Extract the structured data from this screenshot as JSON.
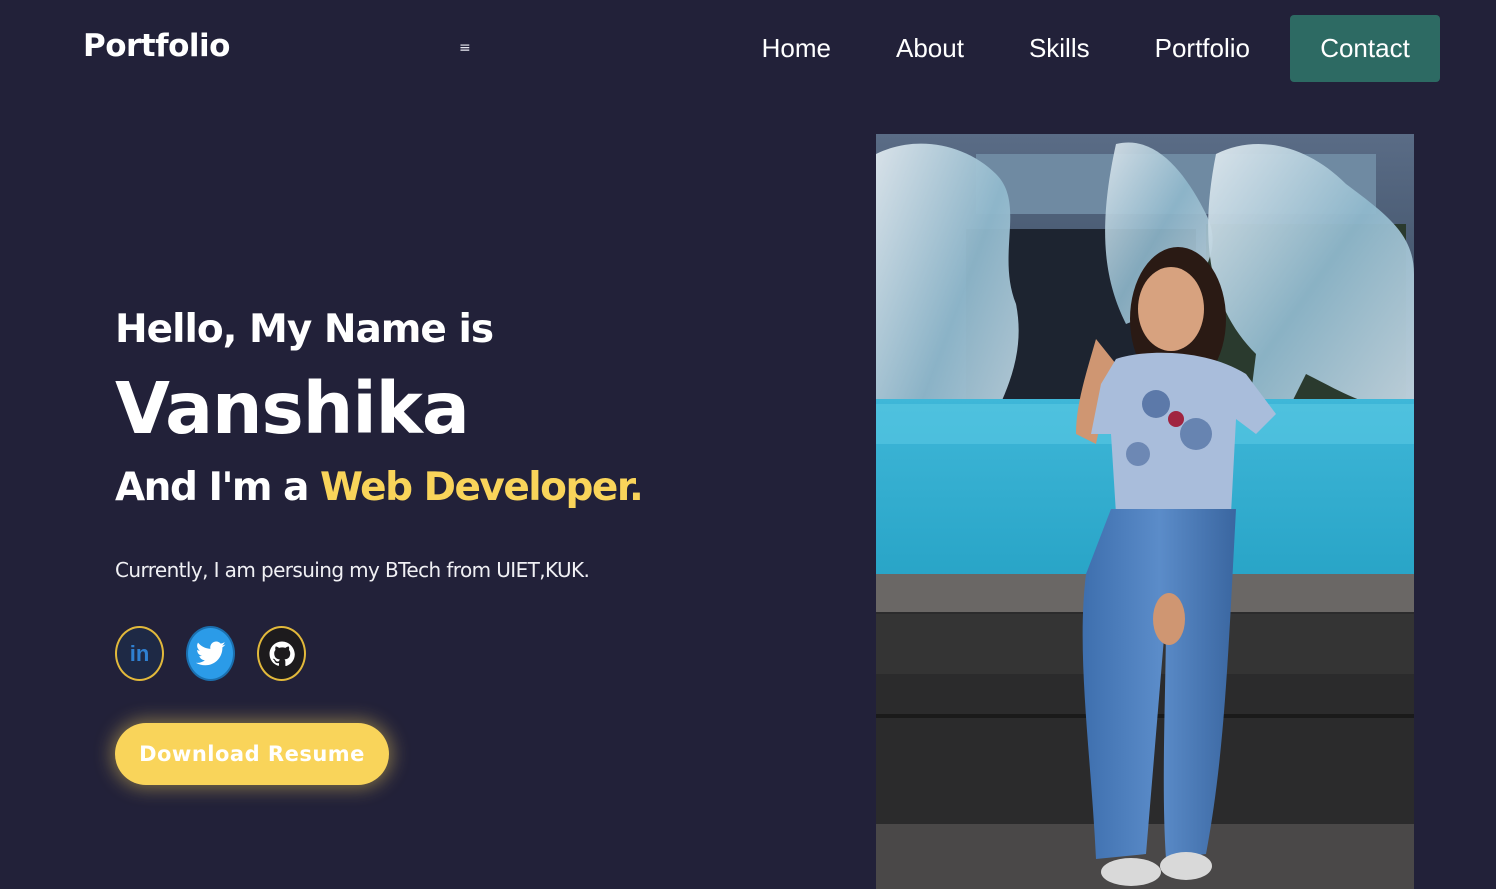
{
  "navbar": {
    "brand": "Portfolio",
    "menu_icon": "hamburger-icon",
    "links": [
      {
        "label": "Home"
      },
      {
        "label": "About"
      },
      {
        "label": "Skills"
      },
      {
        "label": "Portfolio"
      },
      {
        "label": "Contact"
      }
    ]
  },
  "hero": {
    "greeting": "Hello, My Name is",
    "name": "Vanshika",
    "role_prefix": "And I'm a ",
    "role_highlight": "Web Developer.",
    "description": "Currently, I am persuing my BTech from UIET,KUK.",
    "socials": [
      {
        "icon": "linkedin-icon",
        "text": "in"
      },
      {
        "icon": "twitter-icon"
      },
      {
        "icon": "github-icon"
      }
    ],
    "resume_button": "Download Resume"
  },
  "colors": {
    "background": "#222139",
    "accent": "#f9d45a",
    "contact_button": "#2d6a63",
    "text": "#ffffff"
  }
}
